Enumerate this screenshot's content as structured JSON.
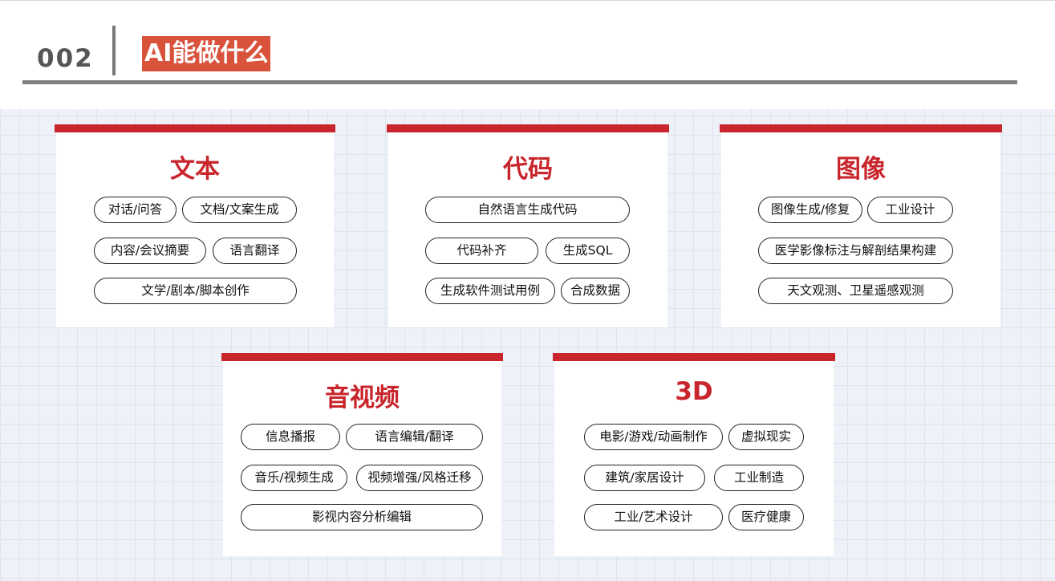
{
  "header": {
    "page_number": "002",
    "title": "AI能做什么"
  },
  "colors": {
    "accent": "#c9252c",
    "title_bg": "#d9533c",
    "rule": "#808080"
  },
  "cards": [
    {
      "title": "文本",
      "tags": [
        "对话/问答",
        "文档/文案生成",
        "内容/会议摘要",
        "语言翻译",
        "文学/剧本/脚本创作"
      ]
    },
    {
      "title": "代码",
      "tags": [
        "自然语言生成代码",
        "代码补齐",
        "生成SQL",
        "生成软件测试用例",
        "合成数据"
      ]
    },
    {
      "title": "图像",
      "tags": [
        "图像生成/修复",
        "工业设计",
        "医学影像标注与解剖结果构建",
        "天文观测、卫星遥感观测"
      ]
    },
    {
      "title": "音视频",
      "tags": [
        "信息播报",
        "语言编辑/翻译",
        "音乐/视频生成",
        "视频增强/风格迁移",
        "影视内容分析编辑"
      ]
    },
    {
      "title": "3D",
      "tags": [
        "电影/游戏/动画制作",
        "虚拟现实",
        "建筑/家居设计",
        "工业制造",
        "工业/艺术设计",
        "医疗健康"
      ]
    }
  ]
}
